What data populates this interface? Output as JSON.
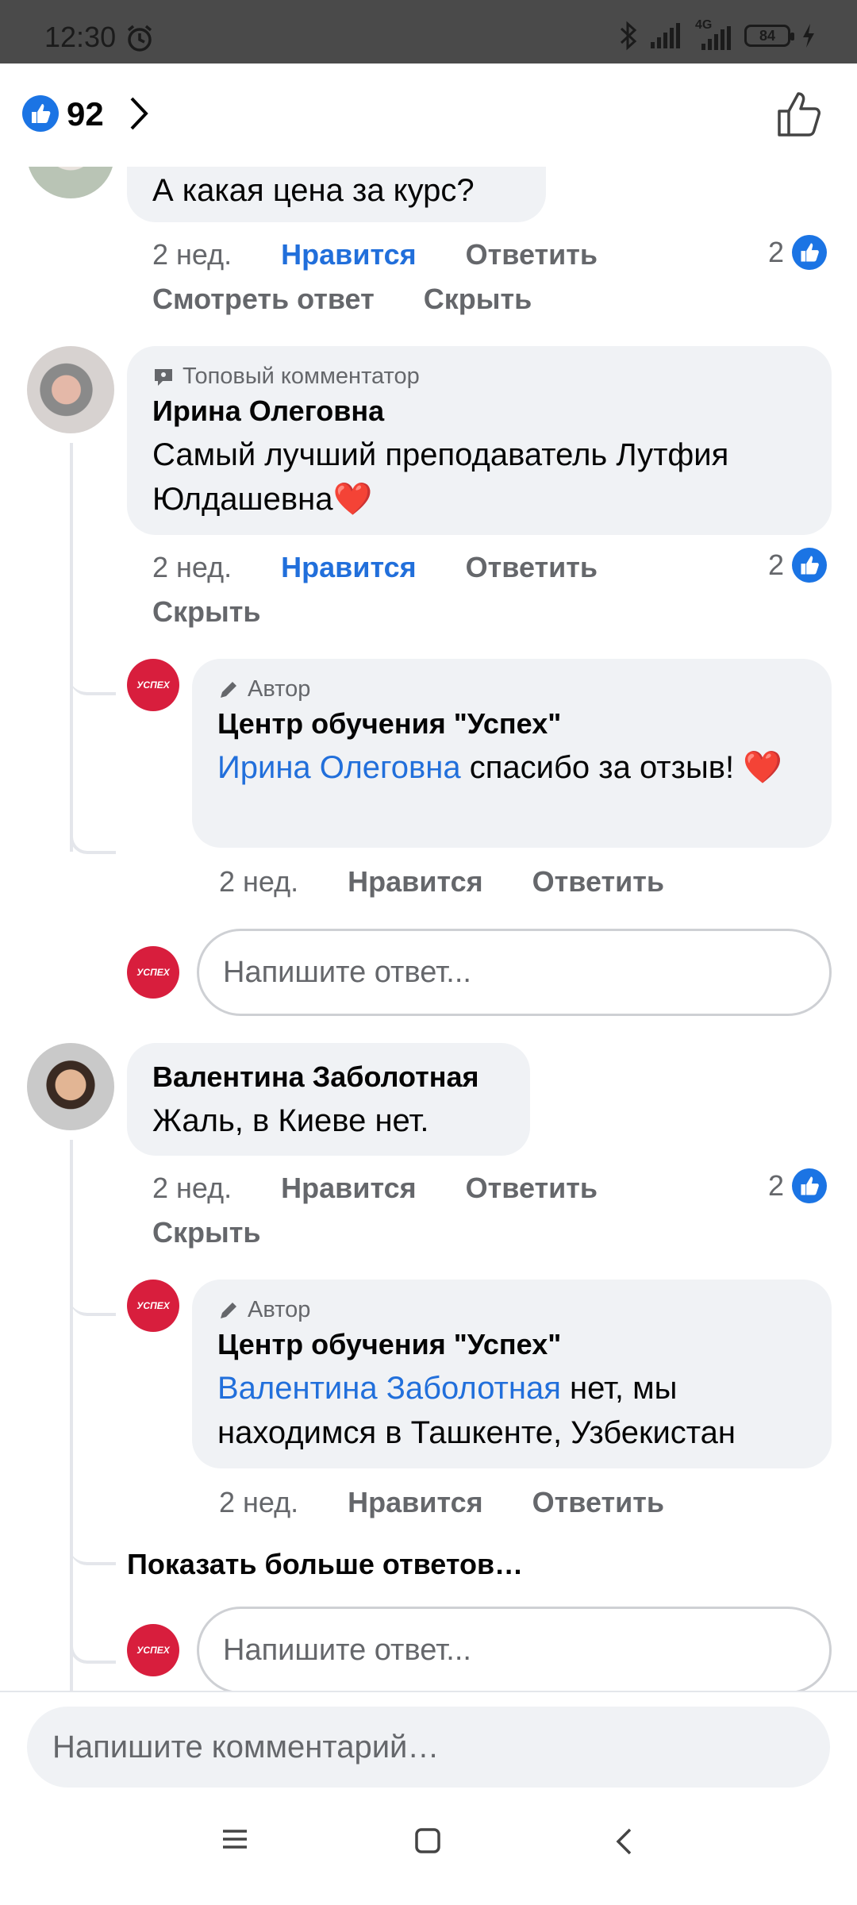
{
  "status_bar": {
    "time": "12:30",
    "network": "4G",
    "battery": "84",
    "icons": [
      "alarm-icon",
      "bluetooth-icon",
      "signal-icon",
      "battery-icon",
      "charging-icon"
    ]
  },
  "header": {
    "like_count": "92"
  },
  "comments": [
    {
      "text": "А какая цена за курс?",
      "time": "2 нед.",
      "like_label": "Нравится",
      "reply_label": "Ответить",
      "reaction_count": "2",
      "view_reply_label": "Смотреть ответ",
      "hide_label": "Скрыть"
    },
    {
      "badge": "Топовый комментатор",
      "name": "Ирина Олеговна",
      "text": "Самый лучший преподаватель Лутфия Юлдашевна❤️",
      "time": "2 нед.",
      "like_label": "Нравится",
      "reply_label": "Ответить",
      "reaction_count": "2",
      "hide_label": "Скрыть",
      "reply": {
        "badge": "Автор",
        "name": "Центр обучения \"Успех\"",
        "mention": "Ирина Олеговна",
        "text": "спасибо за отзыв!",
        "emoji": "❤️",
        "time": "2 нед.",
        "like_label": "Нравится",
        "reply_label": "Ответить"
      },
      "reply_placeholder": "Напишите ответ..."
    },
    {
      "name": "Валентина Заболотная",
      "text": "Жаль, в Киеве нет.",
      "time": "2 нед.",
      "like_label": "Нравится",
      "reply_label": "Ответить",
      "reaction_count": "2",
      "hide_label": "Скрыть",
      "reply": {
        "badge": "Автор",
        "name": "Центр обучения \"Успех\"",
        "mention": "Валентина Заболотная",
        "text": "нет, мы находимся в Ташкенте, Узбекистан",
        "time": "2 нед.",
        "like_label": "Нравится",
        "reply_label": "Ответить"
      },
      "more_replies_label": "Показать больше ответов…",
      "reply_placeholder": "Напишите ответ..."
    }
  ],
  "page_avatar_text": "УСПЕХ",
  "composer": {
    "placeholder": "Напишите комментарий…"
  },
  "colors": {
    "accent": "#216fdb",
    "bubble": "#f0f2f5",
    "muted": "#65676b",
    "brand_red": "#d81e3d"
  }
}
